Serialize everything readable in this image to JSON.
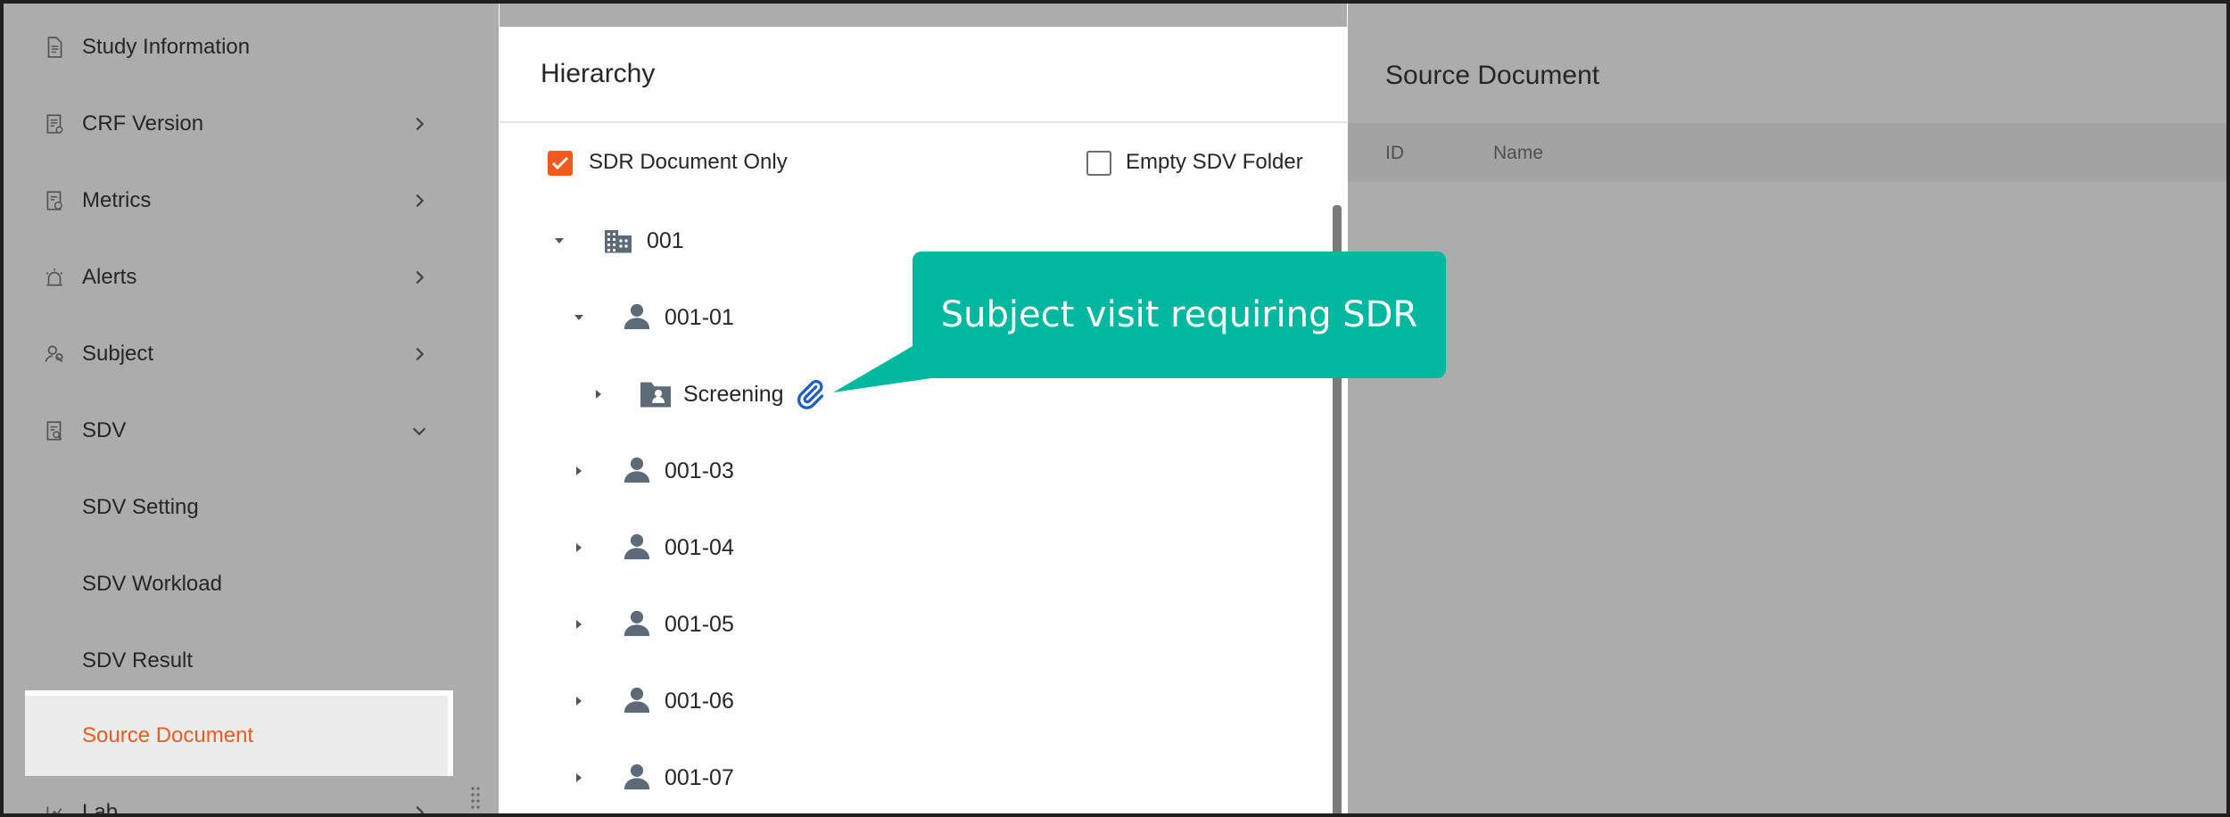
{
  "sidebar": {
    "items": [
      {
        "label": "Study Information",
        "icon": "document-icon",
        "chevron": false
      },
      {
        "label": "CRF Version",
        "icon": "crf-icon",
        "chevron": "right"
      },
      {
        "label": "Metrics",
        "icon": "metrics-icon",
        "chevron": "right"
      },
      {
        "label": "Alerts",
        "icon": "alarm-icon",
        "chevron": "right"
      },
      {
        "label": "Subject",
        "icon": "subject-icon",
        "chevron": "right"
      },
      {
        "label": "SDV",
        "icon": "sdv-icon",
        "chevron": "down"
      }
    ],
    "sub_items": [
      {
        "label": "SDV Setting"
      },
      {
        "label": "SDV Workload"
      },
      {
        "label": "SDV Result"
      },
      {
        "label": "Source Document",
        "active": true
      }
    ],
    "lab_label": "Lab",
    "active_color": "#f25a1f"
  },
  "hierarchy": {
    "title": "Hierarchy",
    "sdr_only_label": "SDR Document Only",
    "sdr_only_checked": true,
    "empty_folder_label": "Empty SDV Folder",
    "empty_folder_checked": false,
    "tree": [
      {
        "label": "001",
        "type": "site",
        "expanded": true,
        "level": 0
      },
      {
        "label": "001-01",
        "type": "subject",
        "expanded": true,
        "level": 1
      },
      {
        "label": "Screening",
        "type": "visit",
        "expanded": false,
        "level": 2,
        "attachment": true
      },
      {
        "label": "001-03",
        "type": "subject",
        "expanded": false,
        "level": 1
      },
      {
        "label": "001-04",
        "type": "subject",
        "expanded": false,
        "level": 1
      },
      {
        "label": "001-05",
        "type": "subject",
        "expanded": false,
        "level": 1
      },
      {
        "label": "001-06",
        "type": "subject",
        "expanded": false,
        "level": 1
      },
      {
        "label": "001-07",
        "type": "subject",
        "expanded": false,
        "level": 1
      }
    ]
  },
  "source_document": {
    "title": "Source Document",
    "columns": [
      "ID",
      "Name"
    ]
  },
  "callout": {
    "text": "Subject visit requiring SDR",
    "color": "#00b79f"
  },
  "colors": {
    "accent": "#f25a1f",
    "overlay": "#acacac",
    "icon": "#5d6b78"
  }
}
